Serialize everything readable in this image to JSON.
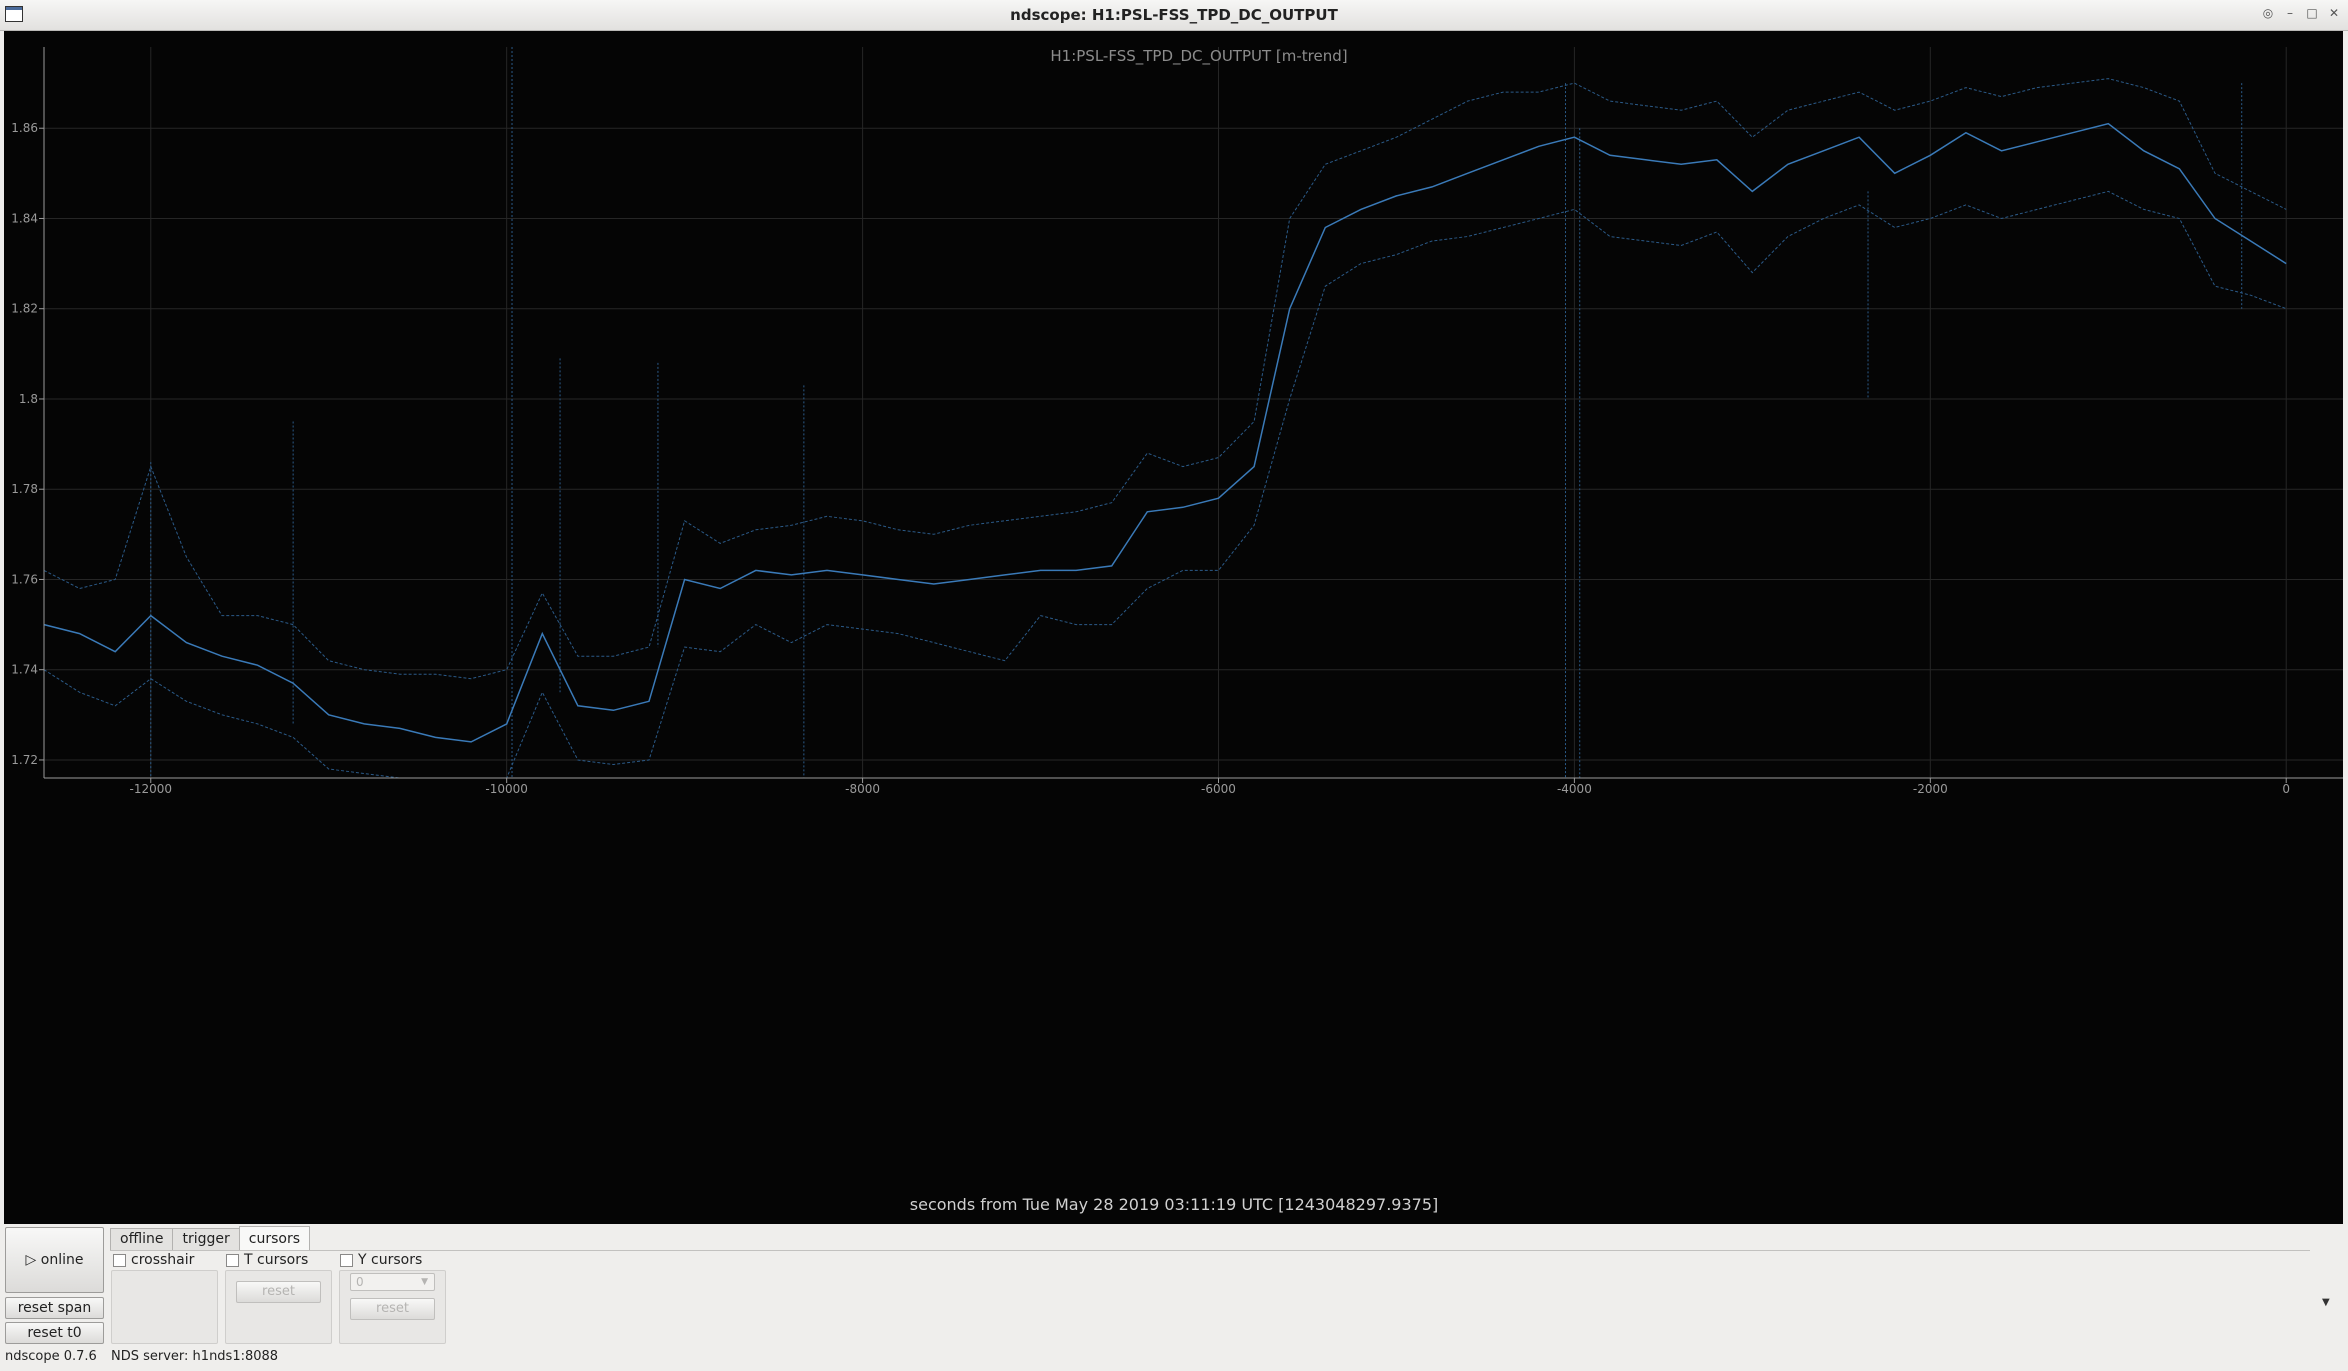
{
  "window": {
    "title": "ndscope: H1:PSL-FSS_TPD_DC_OUTPUT"
  },
  "icons": {
    "app": "window-icon",
    "controls": [
      "pin-icon",
      "minimize-icon",
      "maximize-icon",
      "close-icon"
    ],
    "online": "play-icon",
    "dropdown": "chevron-down-icon"
  },
  "chart_data": {
    "type": "line",
    "title": "H1:PSL-FSS_TPD_DC_OUTPUT [m-trend]",
    "xlabel": "seconds from Tue May 28 2019 03:11:19 UTC [1243048297.9375]",
    "ylabel": "",
    "xlim": [
      -12600,
      100
    ],
    "ylim": [
      1.716,
      1.878
    ],
    "x_ticks": [
      -12000,
      -10000,
      -8000,
      -6000,
      -4000,
      -2000,
      0
    ],
    "x_tick_labels": [
      "-12000",
      "-10000",
      "-8000",
      "-6000",
      "-4000",
      "-2000",
      "0"
    ],
    "y_ticks": [
      1.72,
      1.74,
      1.76,
      1.78,
      1.8,
      1.82,
      1.84,
      1.86
    ],
    "y_tick_labels": [
      "1.72",
      "1.74",
      "1.76",
      "1.78",
      "1.8",
      "1.82",
      "1.84",
      "1.86"
    ],
    "grid": true,
    "colors": {
      "mean": "#3a7ab8",
      "envelope": "#2b5a88",
      "axis": "#9a9a9a",
      "grid": "#262626"
    },
    "x": [
      -12600,
      -12400,
      -12200,
      -12000,
      -11800,
      -11600,
      -11400,
      -11200,
      -11000,
      -10800,
      -10600,
      -10400,
      -10200,
      -10000,
      -9800,
      -9600,
      -9400,
      -9200,
      -9000,
      -8800,
      -8600,
      -8400,
      -8200,
      -8000,
      -7800,
      -7600,
      -7400,
      -7200,
      -7000,
      -6800,
      -6600,
      -6400,
      -6200,
      -6000,
      -5800,
      -5600,
      -5400,
      -5200,
      -5000,
      -4800,
      -4600,
      -4400,
      -4200,
      -4000,
      -3800,
      -3600,
      -3400,
      -3200,
      -3000,
      -2800,
      -2600,
      -2400,
      -2200,
      -2000,
      -1800,
      -1600,
      -1400,
      -1200,
      -1000,
      -800,
      -600,
      -400,
      -200,
      0
    ],
    "series": [
      {
        "role": "mean",
        "values": [
          1.75,
          1.748,
          1.744,
          1.752,
          1.746,
          1.743,
          1.741,
          1.737,
          1.73,
          1.728,
          1.727,
          1.725,
          1.724,
          1.728,
          1.748,
          1.732,
          1.731,
          1.733,
          1.76,
          1.758,
          1.762,
          1.761,
          1.762,
          1.761,
          1.76,
          1.759,
          1.76,
          1.761,
          1.762,
          1.762,
          1.763,
          1.775,
          1.776,
          1.778,
          1.785,
          1.82,
          1.838,
          1.842,
          1.845,
          1.847,
          1.85,
          1.853,
          1.856,
          1.858,
          1.854,
          1.853,
          1.852,
          1.853,
          1.846,
          1.852,
          1.855,
          1.858,
          1.85,
          1.854,
          1.859,
          1.855,
          1.857,
          1.859,
          1.861,
          1.855,
          1.851,
          1.84,
          1.835,
          1.83
        ]
      },
      {
        "role": "max",
        "values": [
          1.762,
          1.758,
          1.76,
          1.785,
          1.765,
          1.752,
          1.752,
          1.75,
          1.742,
          1.74,
          1.739,
          1.739,
          1.738,
          1.74,
          1.757,
          1.743,
          1.743,
          1.745,
          1.773,
          1.768,
          1.771,
          1.772,
          1.774,
          1.773,
          1.771,
          1.77,
          1.772,
          1.773,
          1.774,
          1.775,
          1.777,
          1.788,
          1.785,
          1.787,
          1.795,
          1.84,
          1.852,
          1.855,
          1.858,
          1.862,
          1.866,
          1.868,
          1.868,
          1.87,
          1.866,
          1.865,
          1.864,
          1.866,
          1.858,
          1.864,
          1.866,
          1.868,
          1.864,
          1.866,
          1.869,
          1.867,
          1.869,
          1.87,
          1.871,
          1.869,
          1.866,
          1.85,
          1.846,
          1.842
        ]
      },
      {
        "role": "min",
        "values": [
          1.74,
          1.735,
          1.732,
          1.738,
          1.733,
          1.73,
          1.728,
          1.725,
          1.718,
          1.717,
          1.716,
          1.716,
          1.716,
          1.716,
          1.735,
          1.72,
          1.719,
          1.72,
          1.745,
          1.744,
          1.75,
          1.746,
          1.75,
          1.749,
          1.748,
          1.746,
          1.744,
          1.742,
          1.752,
          1.75,
          1.75,
          1.758,
          1.762,
          1.762,
          1.772,
          1.8,
          1.825,
          1.83,
          1.832,
          1.835,
          1.836,
          1.838,
          1.84,
          1.842,
          1.836,
          1.835,
          1.834,
          1.837,
          1.828,
          1.836,
          1.84,
          1.843,
          1.838,
          1.84,
          1.843,
          1.84,
          1.842,
          1.844,
          1.846,
          1.842,
          1.84,
          1.825,
          1.823,
          1.82
        ]
      }
    ],
    "spikes": [
      {
        "x": -12000,
        "top": 1.786,
        "bottom": 1.716
      },
      {
        "x": -11200,
        "top": 1.795,
        "bottom": 1.728
      },
      {
        "x": -9970,
        "top": 1.878,
        "bottom": 1.716
      },
      {
        "x": -9700,
        "top": 1.809,
        "bottom": 1.735
      },
      {
        "x": -9150,
        "top": 1.808,
        "bottom": 1.745
      },
      {
        "x": -8330,
        "top": 1.803,
        "bottom": 1.716
      },
      {
        "x": -4050,
        "top": 1.87,
        "bottom": 1.716
      },
      {
        "x": -3970,
        "top": 1.86,
        "bottom": 1.716
      },
      {
        "x": -2350,
        "top": 1.846,
        "bottom": 1.8
      },
      {
        "x": -250,
        "top": 1.87,
        "bottom": 1.82
      }
    ]
  },
  "controls": {
    "online_label": "online",
    "reset_span_label": "reset span",
    "reset_t0_label": "reset t0",
    "tabs": [
      "offline",
      "trigger",
      "cursors"
    ],
    "active_tab": "cursors",
    "crosshair_label": "crosshair",
    "t_cursors_label": "T cursors",
    "y_cursors_label": "Y cursors",
    "t_reset_label": "reset",
    "y_reset_label": "reset",
    "y_cursor_select": "0"
  },
  "status": {
    "version": "ndscope 0.7.6",
    "server": "NDS server: h1nds1:8088"
  }
}
